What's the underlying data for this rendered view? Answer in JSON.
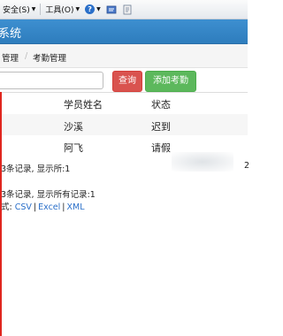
{
  "toolbar": {
    "security_label": "安全(S)",
    "tools_label": "工具(O)",
    "help_glyph": "?"
  },
  "header": {
    "title": "系统"
  },
  "breadcrumb": {
    "parent": "管理",
    "separator": "/",
    "current": "考勤管理"
  },
  "search": {
    "value": "",
    "query_label": "查询",
    "add_label": "添加考勤"
  },
  "table": {
    "columns": [
      "学员姓名",
      "状态"
    ],
    "rows": [
      {
        "name": "沙溪",
        "status": "迟到"
      },
      {
        "name": "阿飞",
        "status": "请假"
      }
    ]
  },
  "footer": {
    "summary_page": "3条记录, 显示所:1",
    "right_mark": "2",
    "summary_all": "3条记录, 显示所有记录:1",
    "export_prefix": "式:",
    "export_csv": "CSV",
    "export_excel": "Excel",
    "export_xml": "XML",
    "export_sep": "|"
  },
  "colors": {
    "header_blue": "#3385c6",
    "query_red": "#d9534f",
    "add_green": "#5cb85c",
    "link_blue": "#2a6fc9",
    "sidebar_red": "#e0261f"
  }
}
